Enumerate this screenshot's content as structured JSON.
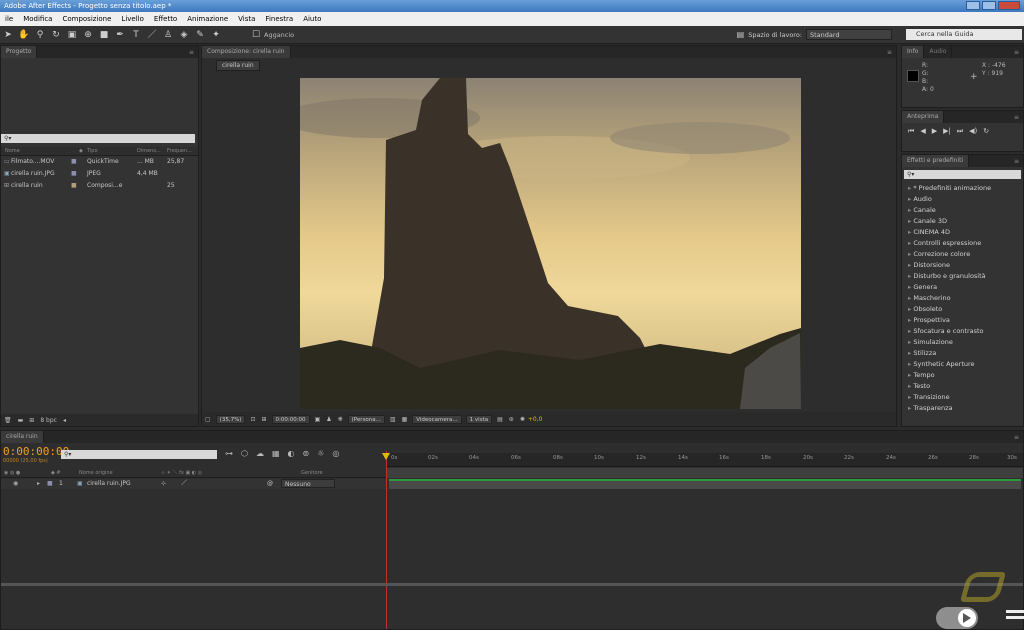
{
  "window": {
    "title": "Adobe After Effects - Progetto senza titolo.aep *"
  },
  "menu": [
    "ile",
    "Modifica",
    "Composizione",
    "Livello",
    "Effetto",
    "Animazione",
    "Vista",
    "Finestra",
    "Aiuto"
  ],
  "toolbar": {
    "snap_label": "Aggancio",
    "workspace_label": "Spazio di lavoro:",
    "workspace_value": "Standard",
    "help_placeholder": "Cerca nella Guida"
  },
  "project": {
    "tab": "Progetto",
    "columns": [
      "Nome",
      "Tipo",
      "Dimens...",
      "Frequen..."
    ],
    "items": [
      {
        "name": "Filmato....MOV",
        "type": "QuickTime",
        "size": "... MB",
        "rate": "25,87"
      },
      {
        "name": "cirella ruin.JPG",
        "type": "JPEG",
        "size": "4,4 MB",
        "rate": ""
      },
      {
        "name": "cirella ruin",
        "type": "Composi...e",
        "size": "",
        "rate": "25"
      }
    ],
    "bpc": "8 bpc"
  },
  "composition": {
    "tab": "Composizione: cirella ruin",
    "breadcrumb": "cirella ruin",
    "zoom": "(35,7%)",
    "timecode": "0:00:00:00",
    "resolution": "(Persona...",
    "camera": "Videocamera...",
    "views": "1 vista",
    "exposure": "+0,0"
  },
  "info": {
    "tabs": [
      "Info",
      "Audio"
    ],
    "labels": [
      "R:",
      "G:",
      "B:",
      "A:"
    ],
    "alpha": "0",
    "x": "X : -476",
    "y": "Y : 919"
  },
  "preview": {
    "tab": "Anteprima"
  },
  "effects": {
    "tab": "Effetti e predefiniti",
    "items": [
      "* Predefiniti animazione",
      "Audio",
      "Canale",
      "Canale 3D",
      "CINEMA 4D",
      "Controlli espressione",
      "Correzione colore",
      "Distorsione",
      "Disturbo e granulosità",
      "Genera",
      "Mascherino",
      "Obsoleto",
      "Prospettiva",
      "Sfocatura e contrasto",
      "Simulazione",
      "Stilizza",
      "Synthetic Aperture",
      "Tempo",
      "Testo",
      "Transizione",
      "Trasparenza"
    ]
  },
  "timeline": {
    "tab": "cirella ruin",
    "timecode": "0:00:00:00",
    "fps": "00000 (25,00 fps)",
    "col_source": "Nome origine",
    "col_parent": "Genitore",
    "layer": {
      "index": "1",
      "name": "cirella ruin.JPG",
      "parent": "Nessuno"
    },
    "ticks": [
      "0s",
      "02s",
      "04s",
      "06s",
      "08s",
      "10s",
      "12s",
      "14s",
      "16s",
      "18s",
      "20s",
      "22s",
      "24s",
      "26s",
      "28s",
      "30s"
    ]
  },
  "colors": {
    "accent": "#e8b800",
    "timecode": "#f0a020",
    "layer_bar": "#2a9a3a",
    "sky_top": "#a99a7c",
    "sky_bottom": "#e9cf8a"
  }
}
